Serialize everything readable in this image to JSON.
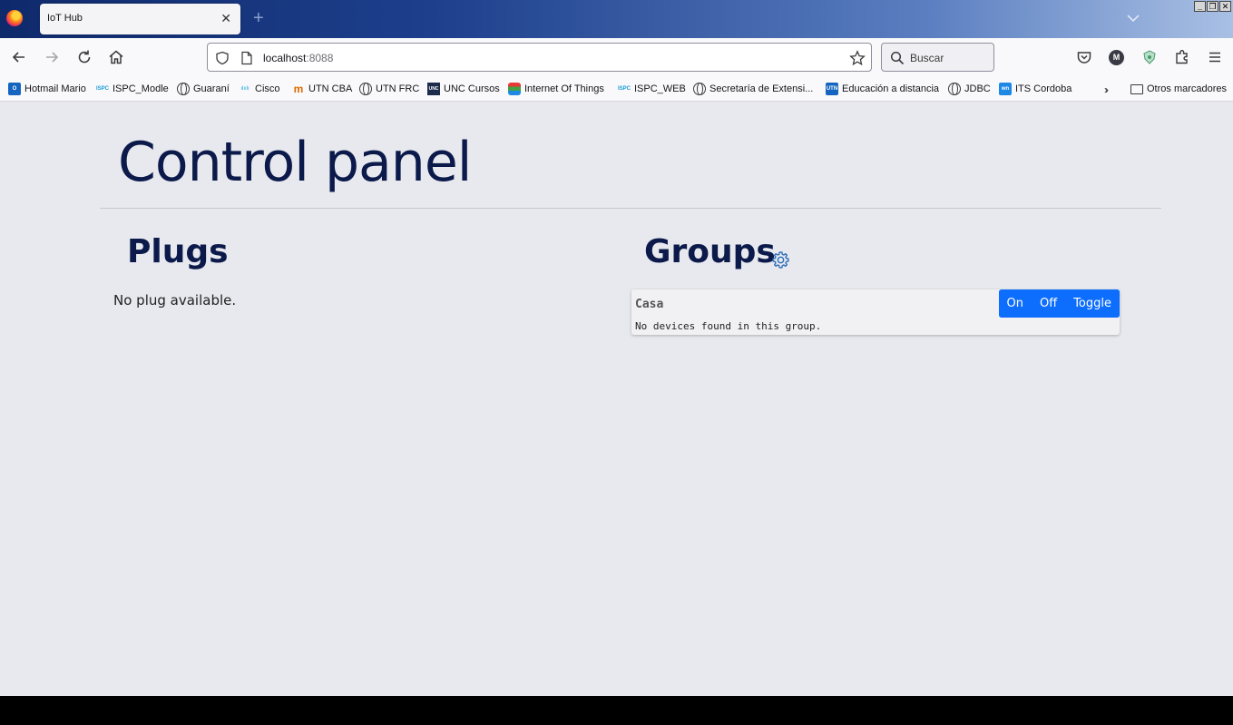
{
  "browser": {
    "tab": {
      "title": "IoT Hub",
      "close": "✕"
    },
    "new_tab": "+",
    "window_controls": [
      "_",
      "❐",
      "✕"
    ],
    "url": {
      "host": "localhost",
      "port": ":8088"
    },
    "search": {
      "placeholder": "Buscar"
    },
    "account_initial": "M",
    "bookmarks": [
      {
        "label": "Hotmail Mario",
        "icon": "outlook-icon"
      },
      {
        "label": "ISPC_Modle",
        "icon": "ispc-icon"
      },
      {
        "label": "Guaraní",
        "icon": "globe-icon"
      },
      {
        "label": "Cisco",
        "icon": "cisco-icon"
      },
      {
        "label": "UTN CBA",
        "icon": "moodle-icon"
      },
      {
        "label": "UTN FRC",
        "icon": "globe-icon"
      },
      {
        "label": "UNC Cursos",
        "icon": "unc-icon"
      },
      {
        "label": "Internet Of Things",
        "icon": "iot-icon"
      },
      {
        "label": "ISPC_WEB",
        "icon": "ispc-icon"
      },
      {
        "label": "Secretaría de Extensi...",
        "icon": "globe-icon"
      },
      {
        "label": "Educación a distancia",
        "icon": "utn-icon"
      },
      {
        "label": "JDBC",
        "icon": "globe-icon"
      },
      {
        "label": "ITS Cordoba",
        "icon": "wn-icon"
      }
    ],
    "other_bookmarks": "Otros marcadores"
  },
  "page": {
    "title": "Control panel",
    "plugs": {
      "heading": "Plugs",
      "empty_message": "No plug available."
    },
    "groups": {
      "heading": "Groups",
      "items": [
        {
          "name": "Casa",
          "empty_message": "No devices found in this group.",
          "actions": {
            "on": "On",
            "off": "Off",
            "toggle": "Toggle"
          }
        }
      ]
    }
  },
  "colors": {
    "heading": "#0b1a4a",
    "accent": "#0d6efd",
    "background": "#e8e9ee"
  }
}
